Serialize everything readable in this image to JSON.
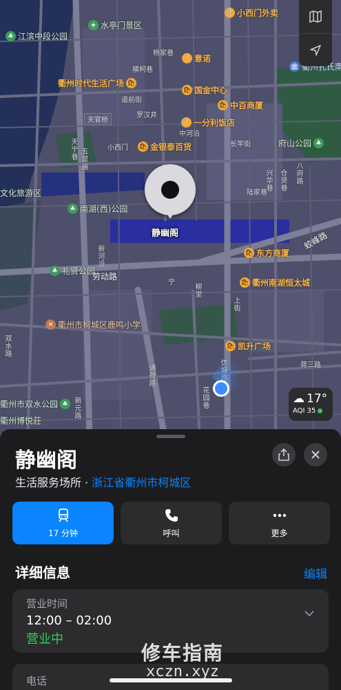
{
  "map": {
    "pois": [
      {
        "name": "小西门外卖",
        "style": "orange",
        "icon": "🍴"
      },
      {
        "name": "水亭门景区",
        "style": "green",
        "icon": "★"
      },
      {
        "name": "江滨中段公园",
        "style": "green",
        "icon": "♣"
      },
      {
        "name": "意诺",
        "style": "orange",
        "icon": "🍴"
      },
      {
        "name": "衢州时代生活广场",
        "style": "orange",
        "icon": "🛍"
      },
      {
        "name": "国金中心",
        "style": "orange",
        "icon": "🛍"
      },
      {
        "name": "中百商厦",
        "style": "orange",
        "icon": "🛍"
      },
      {
        "name": "一分利饭店",
        "style": "orange",
        "icon": "🍴"
      },
      {
        "name": "金银泰百货",
        "style": "orange",
        "icon": "🛍"
      },
      {
        "name": "府山公园",
        "style": "green",
        "icon": "♣"
      },
      {
        "name": "文化旅游区",
        "style": "green",
        "icon": "★"
      },
      {
        "name": "南湖(西)公园",
        "style": "green",
        "icon": "♣"
      },
      {
        "name": "东方商厦",
        "style": "orange",
        "icon": "🛍"
      },
      {
        "name": "礼贤公园",
        "style": "green",
        "icon": "♣"
      },
      {
        "name": "衢州南湖恒太城",
        "style": "orange",
        "icon": "🛍"
      },
      {
        "name": "衢州市柯城区鹿鸣小学",
        "style": "brown",
        "icon": "✕"
      },
      {
        "name": "凯升广场",
        "style": "orange",
        "icon": "🛍"
      },
      {
        "name": "衢州市双水公园",
        "style": "green",
        "icon": "♣"
      },
      {
        "name": "衢州孔氏南",
        "style": "blue",
        "icon": "🏛"
      },
      {
        "name": "衢州博悦莊",
        "style": "green",
        "icon": "♣"
      }
    ],
    "place_box": "天官桥",
    "streets": [
      "杨家巷",
      "横柯巷",
      "道前街",
      "罗汉井",
      "中河沿",
      "小西门",
      "天宁巷",
      "五显庙",
      "长竿街",
      "陆家巷",
      "新河沿",
      "兴华巷",
      "仓贤巷",
      "柳堂",
      "八府路",
      "宁",
      "上街",
      "荷三路",
      "双水路",
      "仿塘路",
      "通荷路",
      "新元路",
      "花园巷"
    ],
    "road_labels": [
      "劳动路",
      "蛟峰路"
    ],
    "selected_label": "静幽阁",
    "weather": {
      "temp": "17°",
      "aqi": "AQI 35"
    }
  },
  "sheet": {
    "title": "静幽阁",
    "category": "生活服务场所",
    "separator": "·",
    "location_link": "浙江省衢州市柯城区",
    "actions": [
      {
        "label": "17 分钟",
        "icon": "train-icon"
      },
      {
        "label": "呼叫",
        "icon": "phone-icon"
      },
      {
        "label": "更多",
        "icon": "ellipsis-icon"
      }
    ],
    "details_title": "详细信息",
    "edit_label": "编辑",
    "hours_label": "营业时间",
    "hours_value": "12:00 – 02:00",
    "hours_status": "营业中",
    "phone_label": "电话"
  },
  "watermark": {
    "line1": "修车指南",
    "line2": "xczn.xyz"
  },
  "colors": {
    "accent": "#0a84ff",
    "open": "#30d158",
    "poi_orange": "#f2a93b",
    "park_green": "#3f9d5c"
  }
}
